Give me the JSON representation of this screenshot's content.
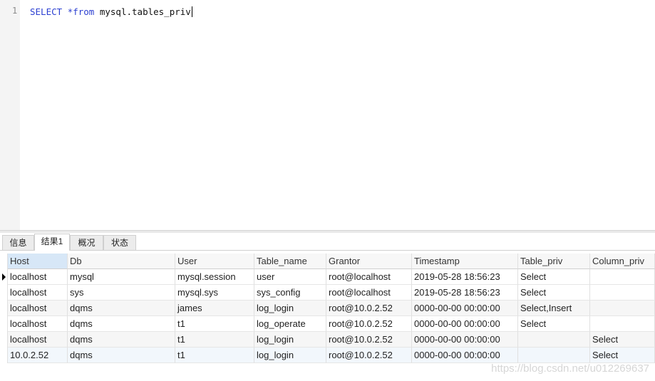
{
  "editor": {
    "line_number": "1",
    "tokens": {
      "select": "SELECT",
      "star": "*",
      "from": "from",
      "table": "mysql.tables_priv"
    }
  },
  "tabs": [
    "信息",
    "结果1",
    "概况",
    "状态"
  ],
  "active_tab": "结果1",
  "grid": {
    "columns": [
      "Host",
      "Db",
      "User",
      "Table_name",
      "Grantor",
      "Timestamp",
      "Table_priv",
      "Column_priv"
    ],
    "rows": [
      [
        "localhost",
        "mysql",
        "mysql.session",
        "user",
        "root@localhost",
        "2019-05-28 18:56:23",
        "Select",
        ""
      ],
      [
        "localhost",
        "sys",
        "mysql.sys",
        "sys_config",
        "root@localhost",
        "2019-05-28 18:56:23",
        "Select",
        ""
      ],
      [
        "localhost",
        "dqms",
        "james",
        "log_login",
        "root@10.0.2.52",
        "0000-00-00 00:00:00",
        "Select,Insert",
        ""
      ],
      [
        "localhost",
        "dqms",
        "t1",
        "log_operate",
        "root@10.0.2.52",
        "0000-00-00 00:00:00",
        "Select",
        ""
      ],
      [
        "localhost",
        "dqms",
        "t1",
        "log_login",
        "root@10.0.2.52",
        "0000-00-00 00:00:00",
        "",
        "Select"
      ],
      [
        "10.0.2.52",
        "dqms",
        "t1",
        "log_login",
        "root@10.0.2.52",
        "0000-00-00 00:00:00",
        "",
        "Select"
      ]
    ]
  },
  "watermark": "https://blog.csdn.net/u012269637",
  "colors": {
    "keyword": "#2b3fd1",
    "header_selected": "#d7e7f7"
  }
}
